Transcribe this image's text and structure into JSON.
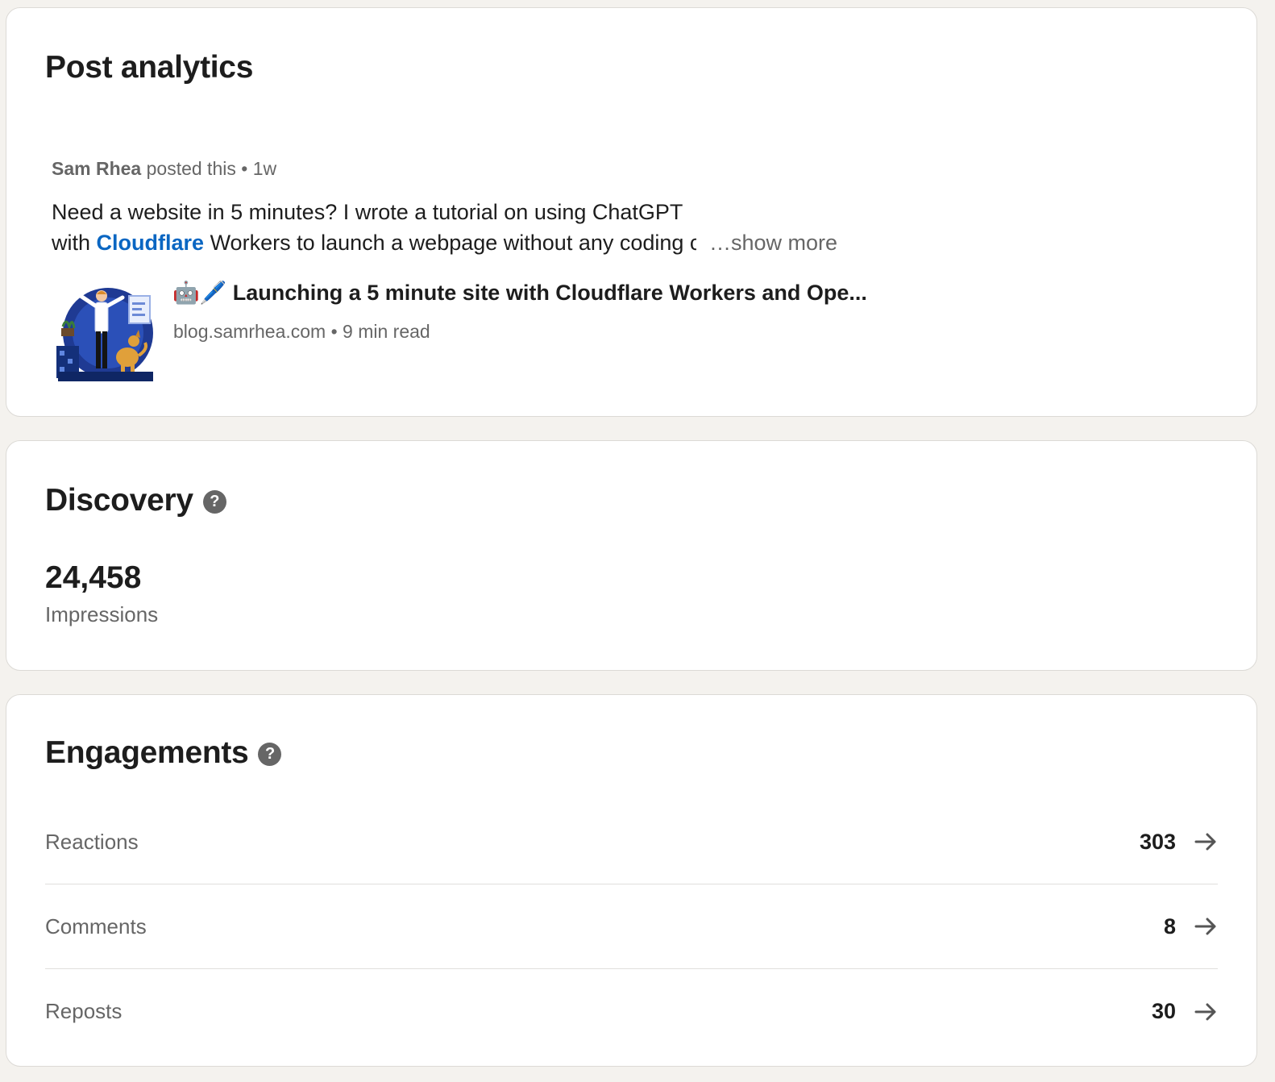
{
  "post_card": {
    "title": "Post analytics",
    "author": "Sam Rhea",
    "posted_text": "posted this",
    "separator": "•",
    "age": "1w",
    "text_line1": "Need a website in 5 minutes? I wrote a tutorial on using ChatGPT",
    "text_line2_prefix": "with",
    "text_link": "Cloudflare",
    "text_line2_suffix": "Workers to launch a webpage without any coding c",
    "show_more": "…show more",
    "article": {
      "emoji": "🤖🖊️",
      "title": "Launching a 5 minute site with Cloudflare Workers and Ope...",
      "domain": "blog.samrhea.com",
      "separator": "•",
      "read_time": "9 min read"
    }
  },
  "discovery": {
    "title": "Discovery",
    "help_icon": "?",
    "value": "24,458",
    "label": "Impressions"
  },
  "engagements": {
    "title": "Engagements",
    "help_icon": "?",
    "rows": [
      {
        "label": "Reactions",
        "value": "303"
      },
      {
        "label": "Comments",
        "value": "8"
      },
      {
        "label": "Reposts",
        "value": "30"
      }
    ]
  },
  "colors": {
    "background": "#f4f2ee",
    "card": "#ffffff",
    "link": "#0a66c2",
    "muted_text": "#666666",
    "primary_text": "#1d1d1d"
  }
}
